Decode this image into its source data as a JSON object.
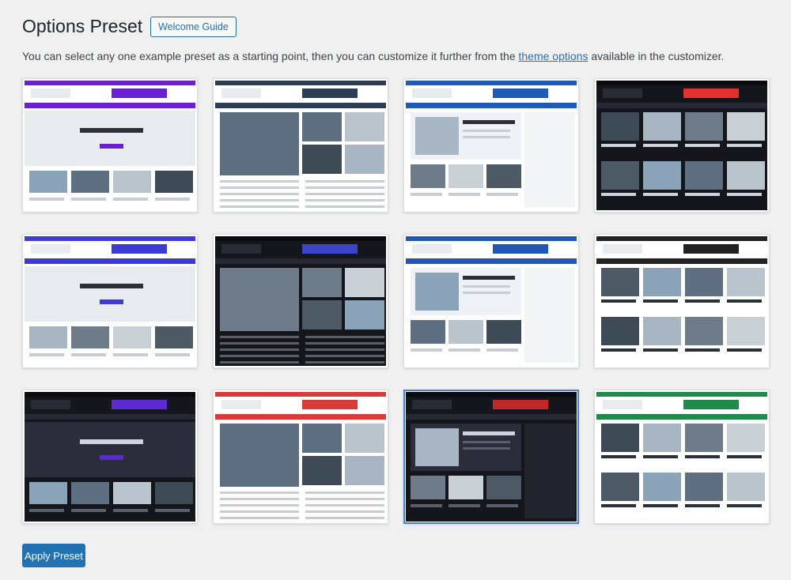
{
  "header": {
    "title": "Options Preset",
    "welcome_button": "Welcome Guide"
  },
  "description": {
    "before": "You can select any one example preset as a starting point, then you can customize it further from the",
    "link": "theme options",
    "after": "available in the customizer."
  },
  "presets": [
    {
      "id": "premium",
      "accent": "#6a1fd1",
      "theme": "light"
    },
    {
      "id": "blog",
      "accent": "#2c3e55",
      "theme": "light"
    },
    {
      "id": "news",
      "accent": "#1e5ab8",
      "theme": "light"
    },
    {
      "id": "dark",
      "accent": "#e2322e",
      "theme": "dark"
    },
    {
      "id": "grid-blogs",
      "accent": "#3b3bd6",
      "theme": "light"
    },
    {
      "id": "grid-dark",
      "accent": "#3a45c8",
      "theme": "dark"
    },
    {
      "id": "media",
      "accent": "#2257b5",
      "theme": "light"
    },
    {
      "id": "masonry-blogs",
      "accent": "#222222",
      "theme": "light"
    },
    {
      "id": "masonry-dark",
      "accent": "#5b2bd1",
      "theme": "dark"
    },
    {
      "id": "news-alt",
      "accent": "#d93b3b",
      "theme": "light"
    },
    {
      "id": "news-dark",
      "accent": "#c0282a",
      "theme": "dark",
      "selected": true
    },
    {
      "id": "green",
      "accent": "#1f8a4c",
      "theme": "light"
    }
  ],
  "apply_button": "Apply Preset"
}
